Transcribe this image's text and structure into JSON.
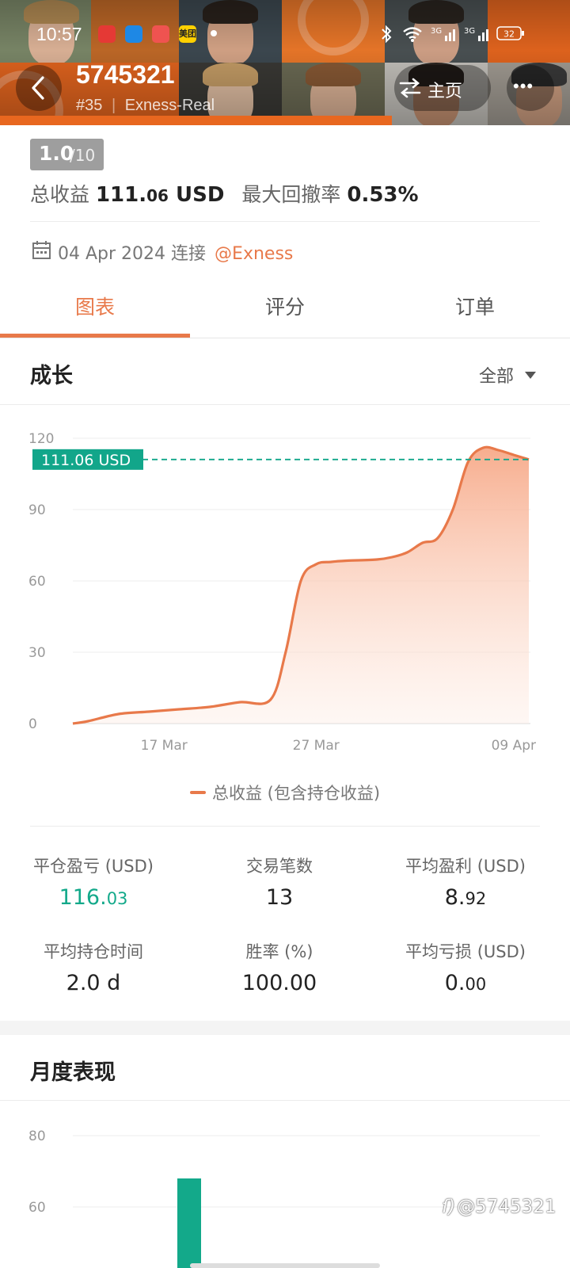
{
  "status_bar": {
    "time": "10:57",
    "battery": "32",
    "network_1": "3G",
    "network_2": "3G",
    "app_badge": "美团"
  },
  "header": {
    "account_id": "5745321",
    "rank": "#35",
    "server": "Exness-Real",
    "home_label": "主页",
    "more_label": "•••"
  },
  "score": {
    "value": "1.0",
    "max": "/10"
  },
  "summary": {
    "total_profit_label": "总收益",
    "total_profit_int": "111.",
    "total_profit_dec": "06",
    "total_profit_unit": " USD",
    "max_drawdown_label": "最大回撤率",
    "max_drawdown_value": "0.53%"
  },
  "connection": {
    "date": "04 Apr 2024",
    "text": "连接",
    "broker": "@Exness"
  },
  "tabs": [
    {
      "label": "图表",
      "active": true
    },
    {
      "label": "评分",
      "active": false
    },
    {
      "label": "订单",
      "active": false
    }
  ],
  "growth": {
    "title": "成长",
    "filter": "全部",
    "current_label": "111.06 USD"
  },
  "chart_data": [
    {
      "type": "area",
      "ylim": [
        0,
        120
      ],
      "y_ticks": [
        "0",
        "30",
        "60",
        "90",
        "120"
      ],
      "x_ticks": [
        "17 Mar",
        "27 Mar",
        "09 Apr"
      ],
      "series": [
        {
          "name": "总收益 (包含持仓收益)",
          "color": "#e8794a",
          "x": [
            "11 Mar",
            "12 Mar",
            "14 Mar",
            "16 Mar",
            "18 Mar",
            "20 Mar",
            "22 Mar",
            "24 Mar",
            "25 Mar",
            "26 Mar",
            "27 Mar",
            "28 Mar",
            "29 Mar",
            "31 Mar",
            "01 Apr",
            "02 Apr",
            "03 Apr",
            "04 Apr",
            "05 Apr",
            "06 Apr",
            "07 Apr",
            "08 Apr",
            "09 Apr",
            "10 Apr"
          ],
          "values": [
            0,
            1,
            4,
            5,
            6,
            7,
            9,
            10,
            30,
            60,
            67,
            68,
            68.5,
            69,
            70,
            72,
            76,
            78,
            90,
            110,
            116,
            115,
            113,
            111.06
          ]
        }
      ],
      "reference_line": {
        "value": 111.06,
        "color": "#12a68a"
      }
    },
    {
      "type": "bar",
      "title": "月度表现",
      "y_ticks": [
        "60",
        "80"
      ],
      "series": [
        {
          "color": "#13a98a",
          "values": [
            68
          ]
        }
      ]
    }
  ],
  "legend": {
    "label": "总收益 (包含持仓收益)"
  },
  "stats": [
    {
      "label": "平仓盈亏 (USD)",
      "int": "116.",
      "dec": "03",
      "color": "#13a98a"
    },
    {
      "label": "交易笔数",
      "int": "13",
      "dec": "",
      "color": "#222222"
    },
    {
      "label": "平均盈利 (USD)",
      "int": "8.",
      "dec": "92",
      "color": "#222222"
    },
    {
      "label": "平均持仓时间",
      "int": "2.0 d",
      "dec": "",
      "color": "#222222"
    },
    {
      "label": "胜率 (%)",
      "int": "100.00",
      "dec": "",
      "color": "#222222"
    },
    {
      "label": "平均亏损 (USD)",
      "int": "0.",
      "dec": "00",
      "color": "#222222"
    }
  ],
  "monthly": {
    "title": "月度表现"
  },
  "watermark": "@5745321",
  "colors": {
    "accent": "#e8671f",
    "green": "#13a98a",
    "area_fill": "#f7a988"
  }
}
